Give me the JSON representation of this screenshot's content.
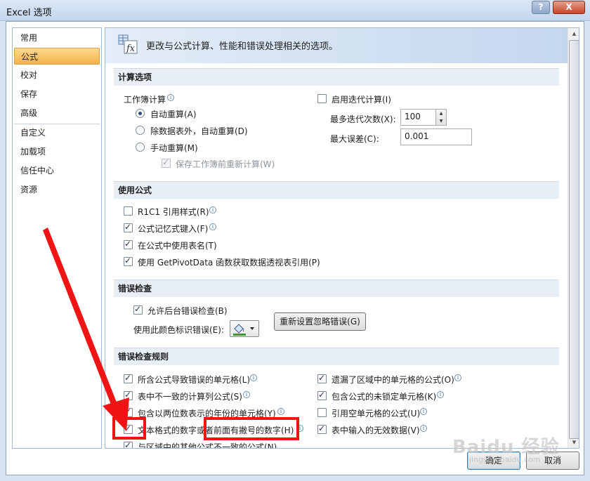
{
  "window": {
    "title": "Excel 选项",
    "help_glyph": "?",
    "close_glyph": "X"
  },
  "nav": {
    "items": [
      "常用",
      "公式",
      "校对",
      "保存",
      "高级",
      "自定义",
      "加载项",
      "信任中心",
      "资源"
    ],
    "active": "公式"
  },
  "header": {
    "text": "更改与公式计算、性能和错误处理相关的选项。"
  },
  "calc": {
    "section": "计算选项",
    "workbook_calc_label": "工作簿计算",
    "radio_auto": "自动重算(A)",
    "radio_auto_except": "除数据表外，自动重算(D)",
    "radio_manual": "手动重算(M)",
    "recalc_before_save": "保存工作簿前重新计算(W)",
    "iterative": "启用迭代计算(I)",
    "max_iter_label": "最多迭代次数(X):",
    "max_iter_value": "100",
    "max_change_label": "最大误差(C):",
    "max_change_value": "0.001"
  },
  "formulas": {
    "section": "使用公式",
    "r1c1": "R1C1 引用样式(R)",
    "autocomplete": "公式记忆式键入(F)",
    "table_names": "在公式中使用表名(T)",
    "getpivot": "使用 GetPivotData 函数获取数据透视表引用(P)"
  },
  "errcheck": {
    "section": "错误检查",
    "bg_check": "允许后台错误检查(B)",
    "color_label": "使用此颜色标识错误(E):",
    "reset_button": "重新设置忽略错误(G)"
  },
  "rules": {
    "section": "错误检查规则",
    "left": [
      "所含公式导致错误的单元格(L)",
      "表中不一致的计算列公式(S)",
      "包含以两位数表示的年份的单元格(Y)",
      "文本格式的数字或者前面有撇号的数字(H)",
      "与区域中的其他公式不一致的公式(N)"
    ],
    "right": [
      "遗漏了区域中的单元格的公式(O)",
      "包含公式的未锁定单元格(K)",
      "引用空单元格的公式(U)",
      "表中输入的无效数据(V)"
    ]
  },
  "footer": {
    "ok": "确定",
    "cancel": "取消"
  },
  "watermark": {
    "brand": "Baidu 经验",
    "url": "jingyan.baidu.com"
  },
  "colors": {
    "highlight": "#f01414",
    "nav_active": "#f5b24a"
  }
}
